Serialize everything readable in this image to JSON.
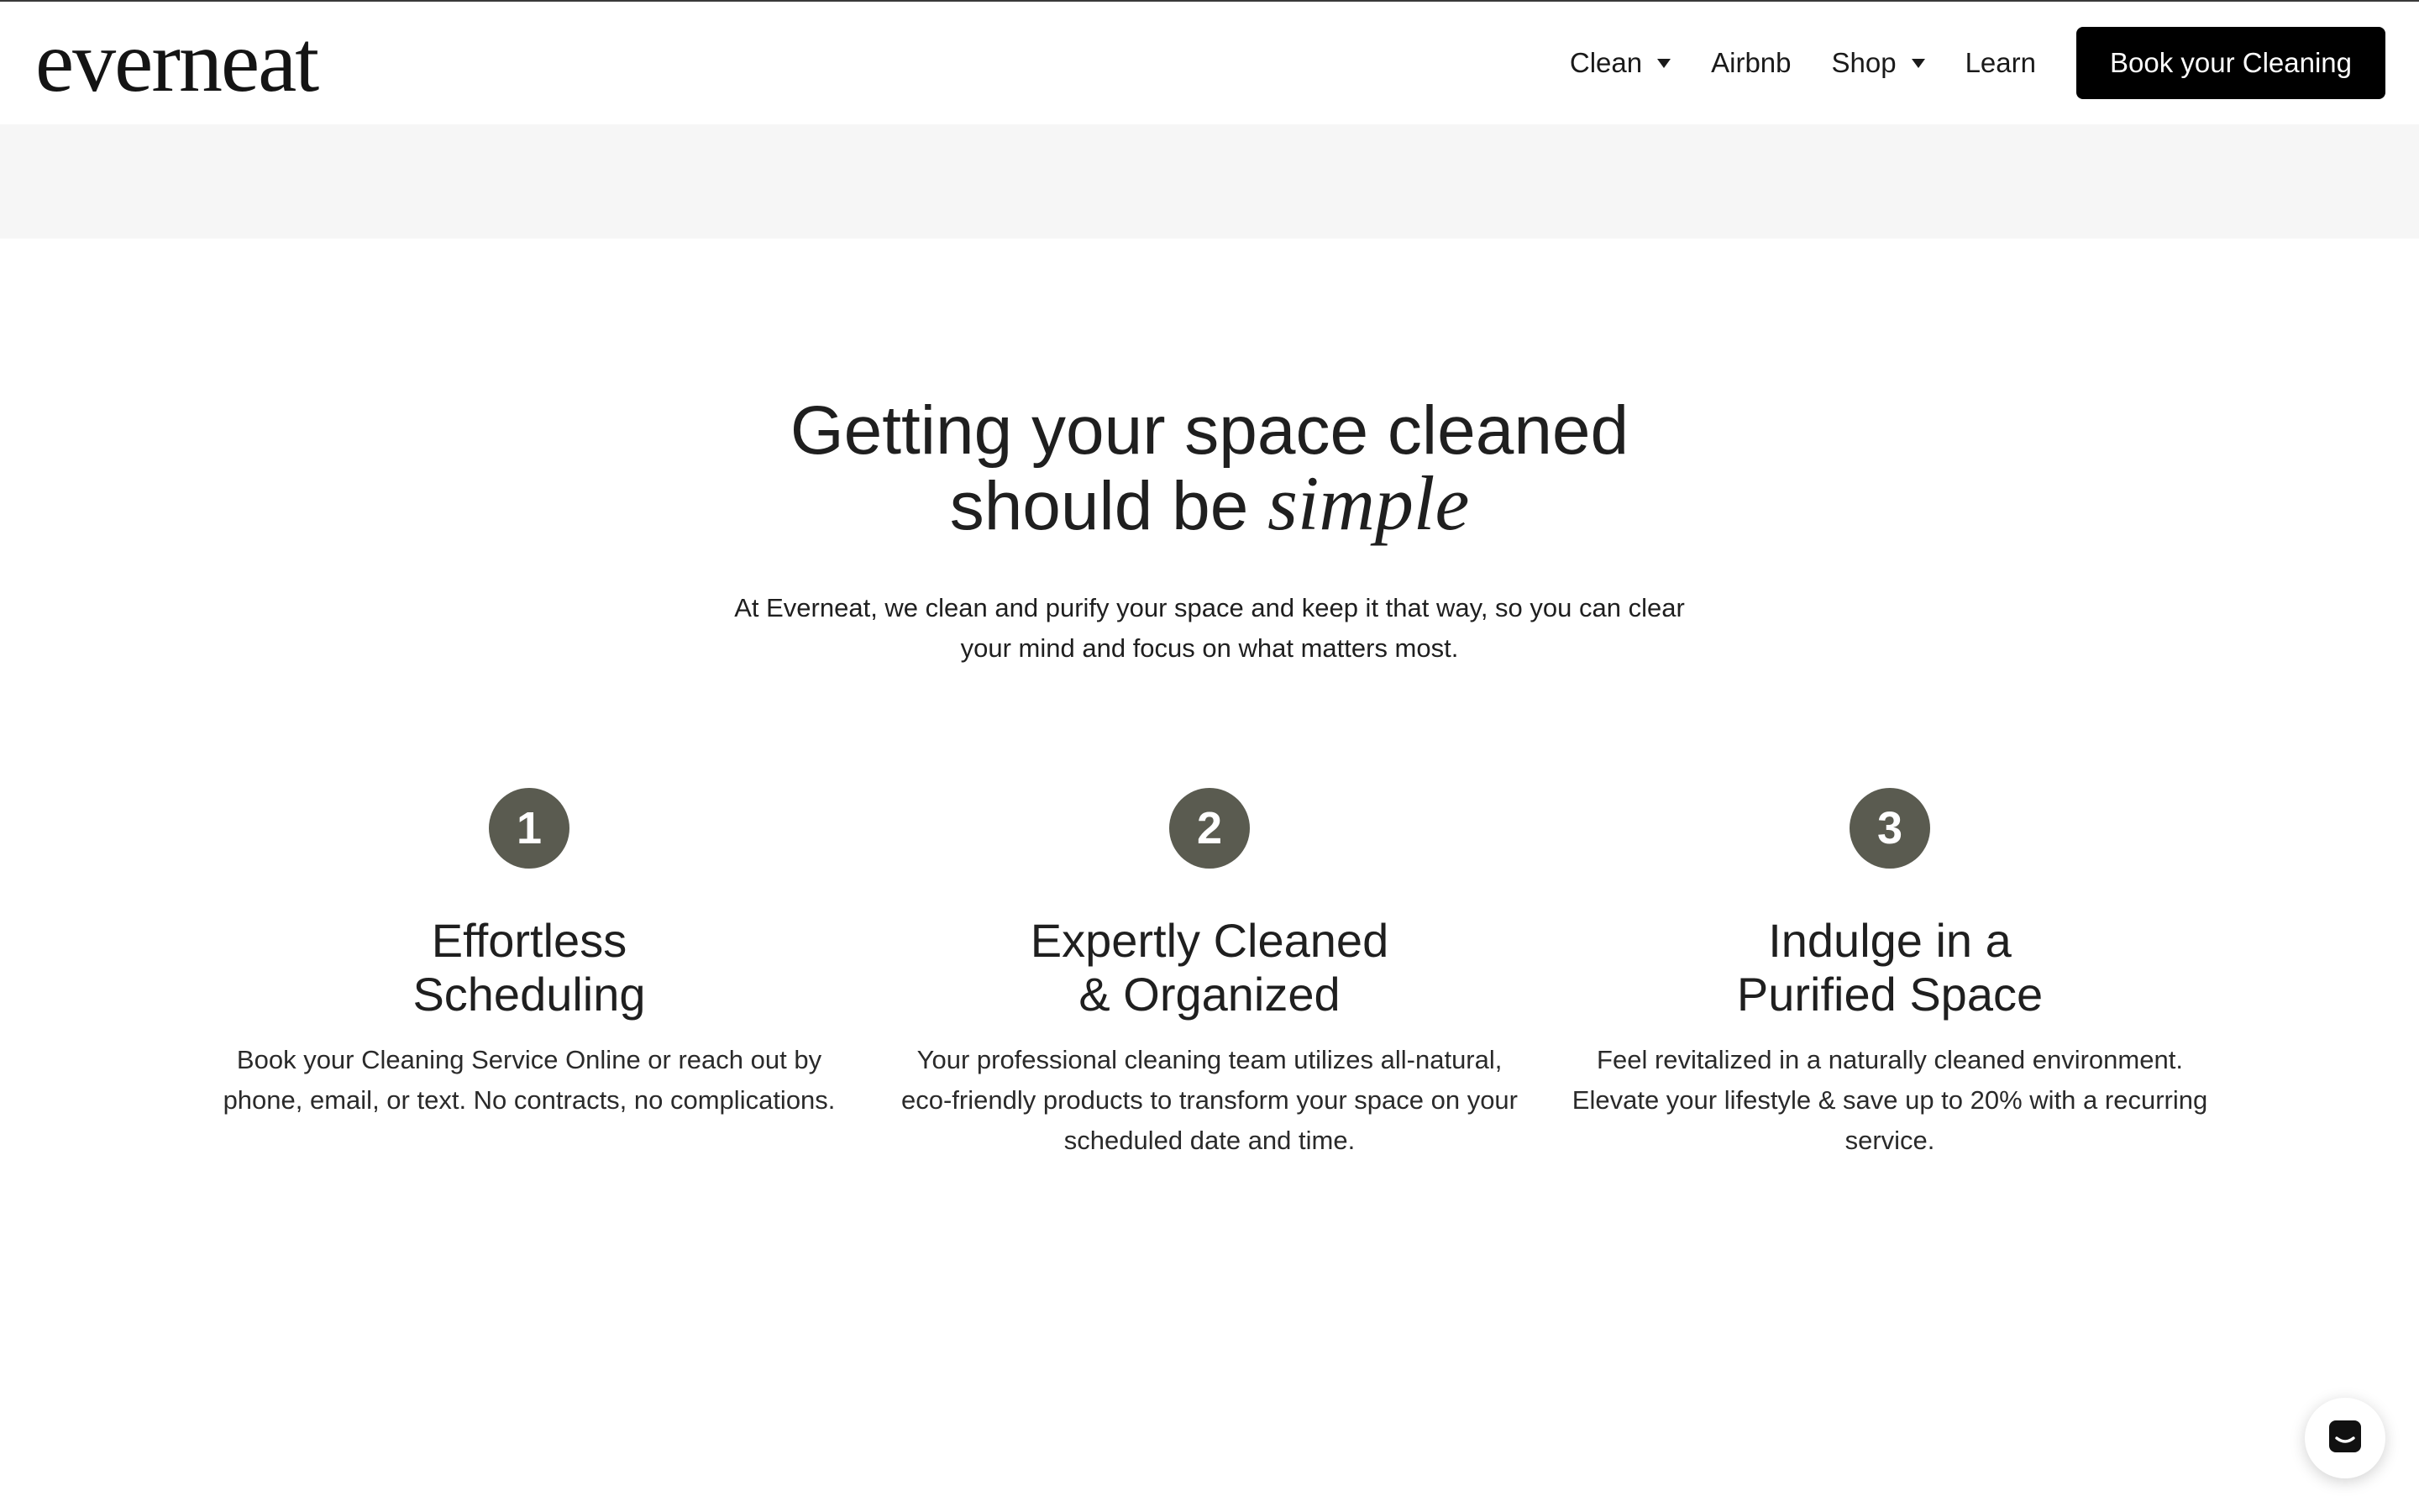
{
  "header": {
    "logo": "everneat",
    "nav": [
      {
        "label": "Clean",
        "dropdown": true
      },
      {
        "label": "Airbnb",
        "dropdown": false
      },
      {
        "label": "Shop",
        "dropdown": true
      },
      {
        "label": "Learn",
        "dropdown": false
      }
    ],
    "cta_label": "Book your Cleaning"
  },
  "hero": {
    "title_line1": "Getting your space cleaned",
    "title_line2_prefix": "should be ",
    "title_line2_italic": "simple",
    "subtitle": "At Everneat, we clean and purify your space and keep it that way, so you can clear your mind and focus on what matters most."
  },
  "steps": [
    {
      "number": "1",
      "title_line1": "Effortless",
      "title_line2": "Scheduling",
      "description": "Book your Cleaning Service Online or reach out by phone, email, or text. No contracts, no complications."
    },
    {
      "number": "2",
      "title_line1": "Expertly Cleaned",
      "title_line2": "& Organized",
      "description": "Your professional cleaning team utilizes all-natural, eco-friendly products to transform your space on your scheduled date and time."
    },
    {
      "number": "3",
      "title_line1": "Indulge in a",
      "title_line2": "Purified Space",
      "description": "Feel revitalized in a naturally cleaned environment. Elevate your lifestyle & save up to 20% with a recurring service."
    }
  ],
  "colors": {
    "step_badge": "#5a5b50",
    "cta_background": "#000000",
    "band": "#f6f6f6"
  },
  "chat_widget": {
    "icon": "chat-bubble-icon"
  }
}
